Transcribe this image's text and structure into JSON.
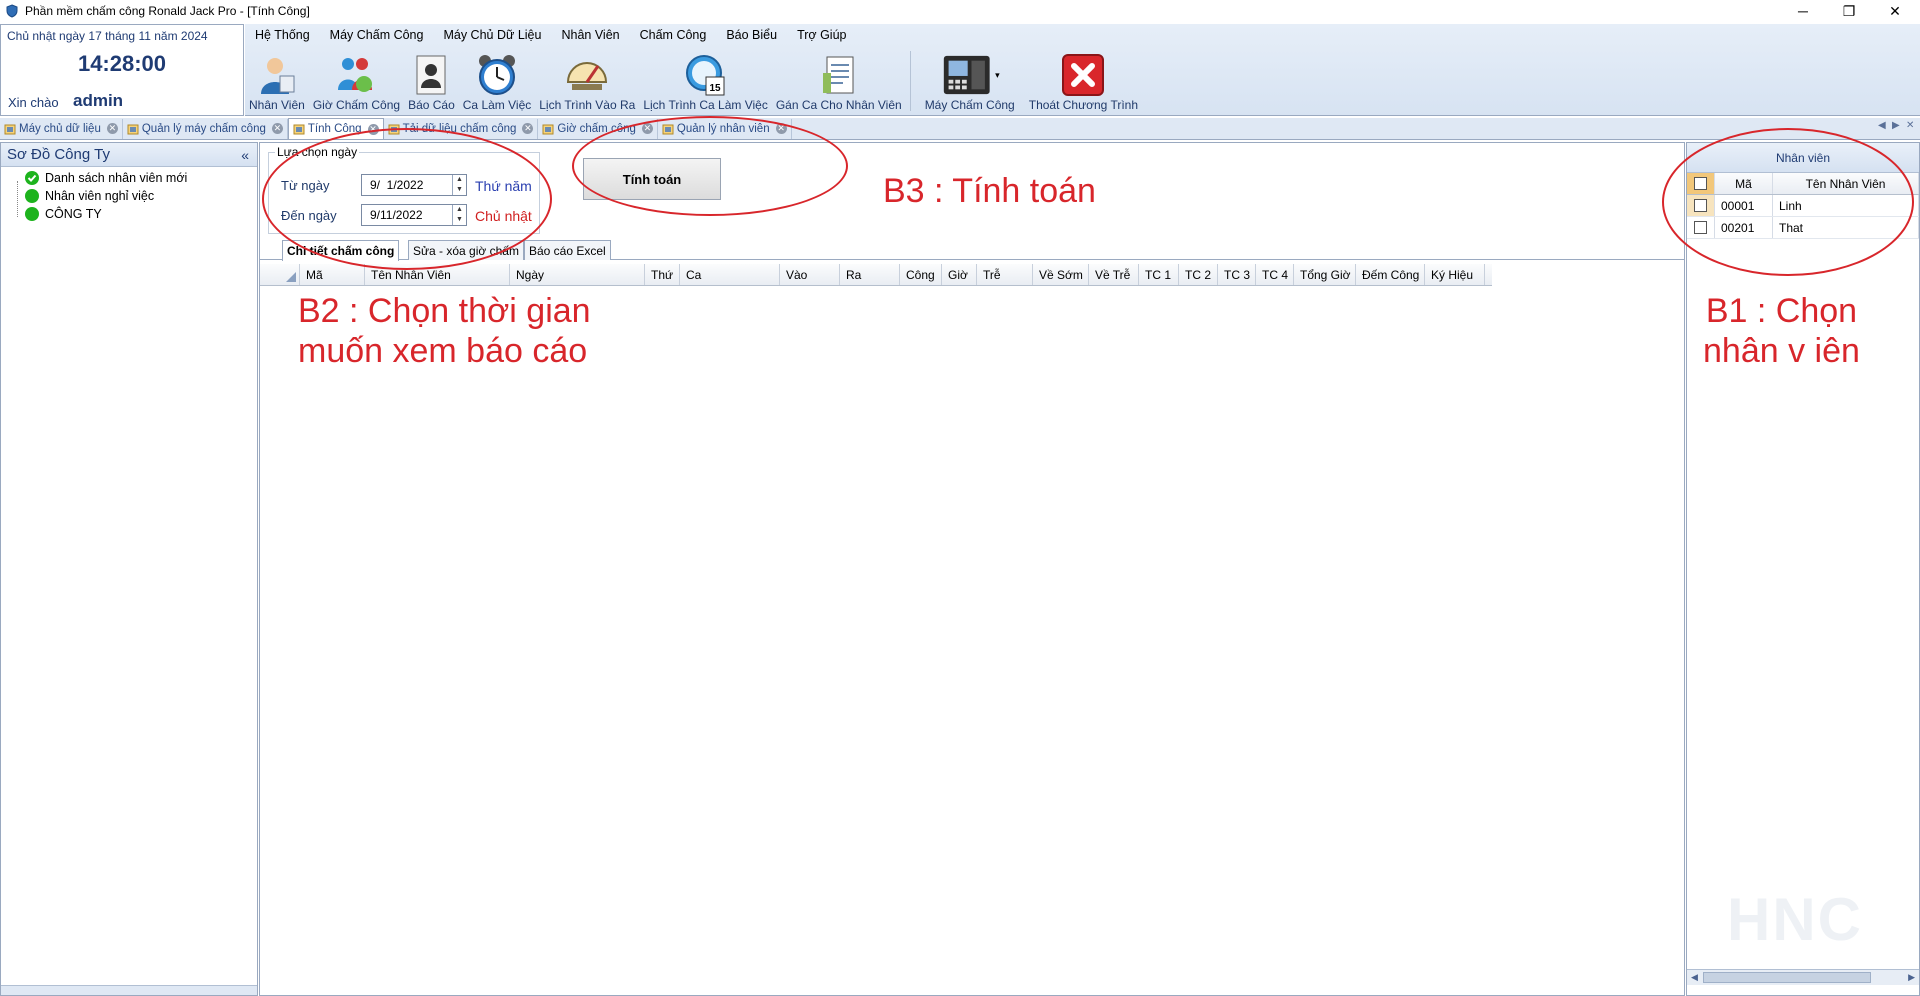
{
  "window": {
    "title": "Phần mềm chấm công Ronald Jack Pro - [Tính Công]",
    "controls": [
      "─",
      "❐",
      "✕"
    ]
  },
  "info": {
    "date": "Chủ nhật ngày 17 tháng 11 năm 2024",
    "time": "14:28:00",
    "greeting": "Xin chào",
    "user": "admin"
  },
  "menu": [
    "Hệ Thống",
    "Máy Chấm Công",
    "Máy Chủ Dữ Liệu",
    "Nhân Viên",
    "Chấm Công",
    "Báo Biểu",
    "Trợ Giúp"
  ],
  "toolbar": [
    {
      "label": "Nhân Viên",
      "icon": "employee-icon"
    },
    {
      "label": "Giờ Chấm Công",
      "icon": "attendance-time-icon"
    },
    {
      "label": "Báo Cáo",
      "icon": "report-icon"
    },
    {
      "label": "Ca Làm Việc",
      "icon": "alarm-clock-icon"
    },
    {
      "label": "Lịch Trình Vào Ra",
      "icon": "gauge-icon"
    },
    {
      "label": "Lịch Trình Ca Làm Việc",
      "icon": "calendar-clock-icon"
    },
    {
      "label": "Gán Ca Cho Nhân Viên",
      "icon": "assign-shift-icon"
    },
    {
      "label": "Máy Chấm Công",
      "icon": "time-clock-device-icon"
    },
    {
      "label": "Thoát Chương Trình",
      "icon": "exit-icon"
    }
  ],
  "doc_tabs": [
    {
      "label": "Máy chủ dữ liệu",
      "active": false
    },
    {
      "label": "Quản lý máy chấm công",
      "active": false
    },
    {
      "label": "Tính Công",
      "active": true
    },
    {
      "label": "Tải dữ liệu chấm công",
      "active": false
    },
    {
      "label": "Giờ chấm công",
      "active": false
    },
    {
      "label": "Quản lý nhân viên",
      "active": false
    }
  ],
  "left_panel": {
    "title": "Sơ Đồ Công Ty",
    "collapse": "«",
    "items": [
      "Danh sách nhân viên mới",
      "Nhân viên nghỉ việc",
      "CÔNG TY"
    ]
  },
  "date_filter": {
    "group_title": "Lựa chọn ngày",
    "from_label": "Từ ngày",
    "from_value": "9/  1/2022",
    "from_day": "Thứ năm",
    "to_label": "Đến ngày",
    "to_value": "9/11/2022",
    "to_day": "Chủ nhật"
  },
  "calc_button": "Tính toán",
  "sub_tabs": [
    "Chi tiết chấm công",
    "Sửa - xóa giờ chấm",
    "Báo cáo Excel"
  ],
  "grid_columns": [
    "Mã",
    "Tên Nhân Viên",
    "Ngày",
    "Thứ",
    "Ca",
    "Vào",
    "Ra",
    "Công",
    "Giờ",
    "Trễ",
    "Về Sớm",
    "Về Trễ",
    "TC 1",
    "TC 2",
    "TC 3",
    "TC 4",
    "Tổng Giờ",
    "Đếm Công",
    "Ký Hiệu"
  ],
  "right_panel": {
    "title": "Nhân viên",
    "col_code": "Mã",
    "col_name": "Tên Nhân Viên",
    "rows": [
      {
        "code": "00001",
        "name": "Linh"
      },
      {
        "code": "00201",
        "name": "That"
      }
    ],
    "watermark": "HNC"
  },
  "annotations": {
    "b1": "B1 : Chọn\nnhân v iên",
    "b2": "B2 : Chọn thời gian\nmuốn xem báo cáo",
    "b3": "B3 : Tính toán",
    "color": "#d8262b"
  }
}
